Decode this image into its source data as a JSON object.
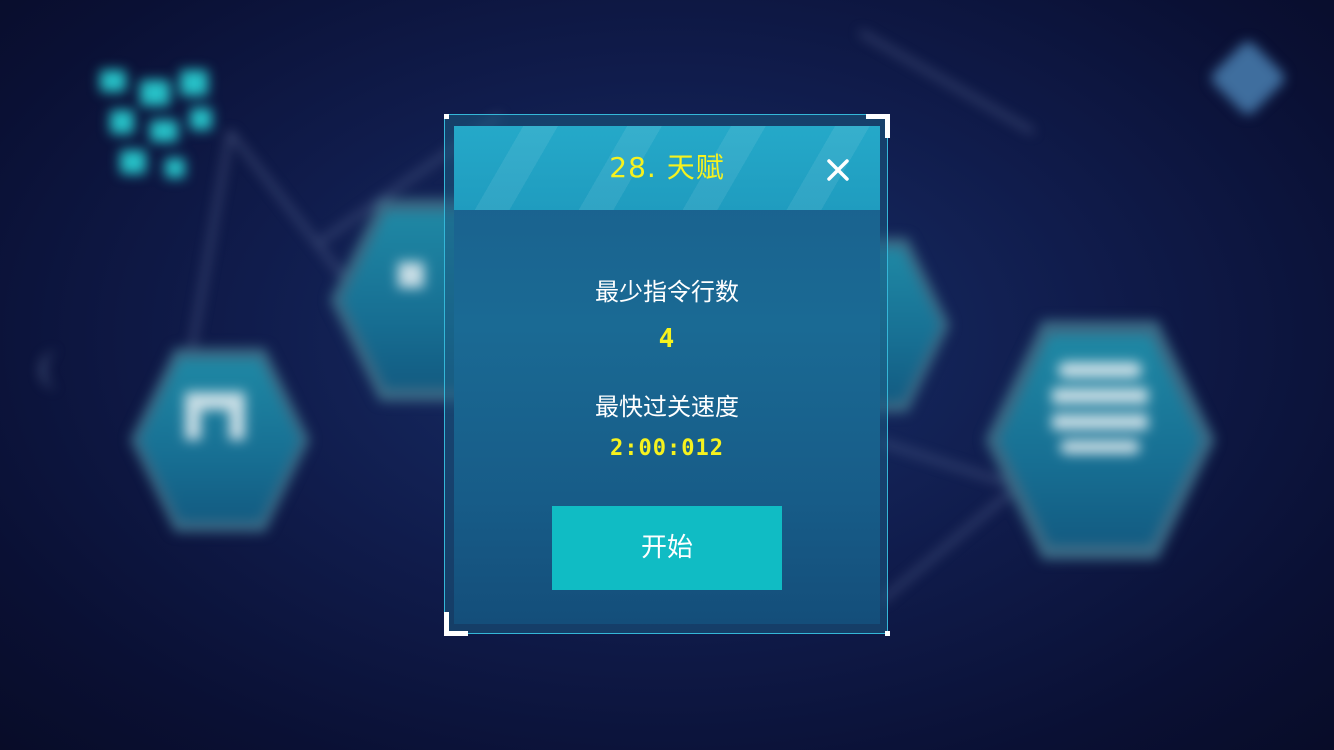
{
  "dialog": {
    "title": "28. 天赋",
    "close_icon": "close-icon",
    "min_lines_label": "最少指令行数",
    "min_lines_value": "4",
    "fastest_time_label": "最快过关速度",
    "fastest_time_value": "2:00:012",
    "start_button_label": "开始"
  },
  "colors": {
    "title": "#f6f21e",
    "value": "#f6f21e",
    "header": "#25a9c9",
    "start_button": "#10bcc4",
    "frame": "#34b7d8"
  }
}
